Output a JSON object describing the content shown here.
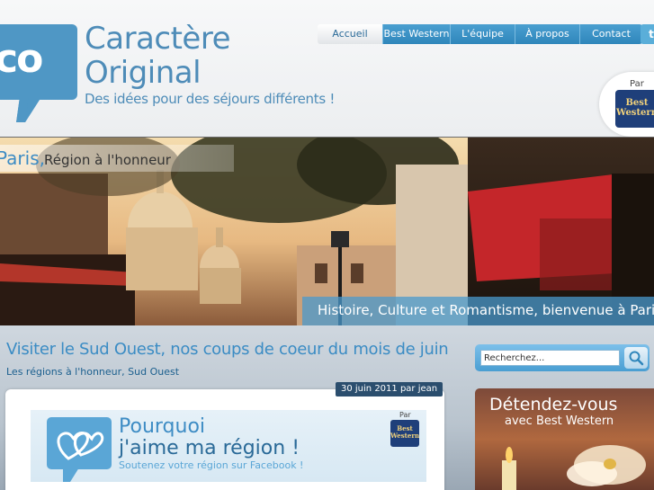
{
  "brand": {
    "logo_mark": "co",
    "name_line1": "Caractère",
    "name_line2": "Original",
    "tagline": "Des idées pour des séjours différents !",
    "color": "#4e8cb8"
  },
  "nav": {
    "items": [
      {
        "label": "Accueil",
        "active": true
      },
      {
        "label": "Best Western",
        "active": false
      },
      {
        "label": "L'équipe",
        "active": false
      },
      {
        "label": "À propos",
        "active": false
      },
      {
        "label": "Contact",
        "active": false
      }
    ],
    "twitter_icon": "twitter-icon"
  },
  "sponsor": {
    "par_label": "Par",
    "logo_line1": "Best",
    "logo_line2": "Western"
  },
  "banner": {
    "city": "Paris,",
    "subtitle": "Région à l'honneur",
    "caption": "Histoire, Culture et Romantisme, bienvenue à Paris"
  },
  "post": {
    "title": "Visiter le Sud Ouest, nos coups de coeur du mois de juin",
    "categories": "Les régions à l'honneur, Sud Ouest",
    "date": "30 juin 2011 par jean",
    "promo": {
      "line1": "Pourquoi",
      "line2": "j'aime ma région !",
      "line3": "Soutenez votre région sur Facebook !",
      "par_label": "Par",
      "logo_line1": "Best",
      "logo_line2": "Western"
    }
  },
  "sidebar": {
    "search_placeholder": "Recherchez...",
    "promo": {
      "line1": "Détendez-vous",
      "line2": "avec Best Western"
    }
  },
  "colors": {
    "accent": "#3b8cc4",
    "nav_blue": "#2f86bb",
    "bw_navy": "#1f3f7a",
    "bw_gold": "#f2d27a"
  }
}
